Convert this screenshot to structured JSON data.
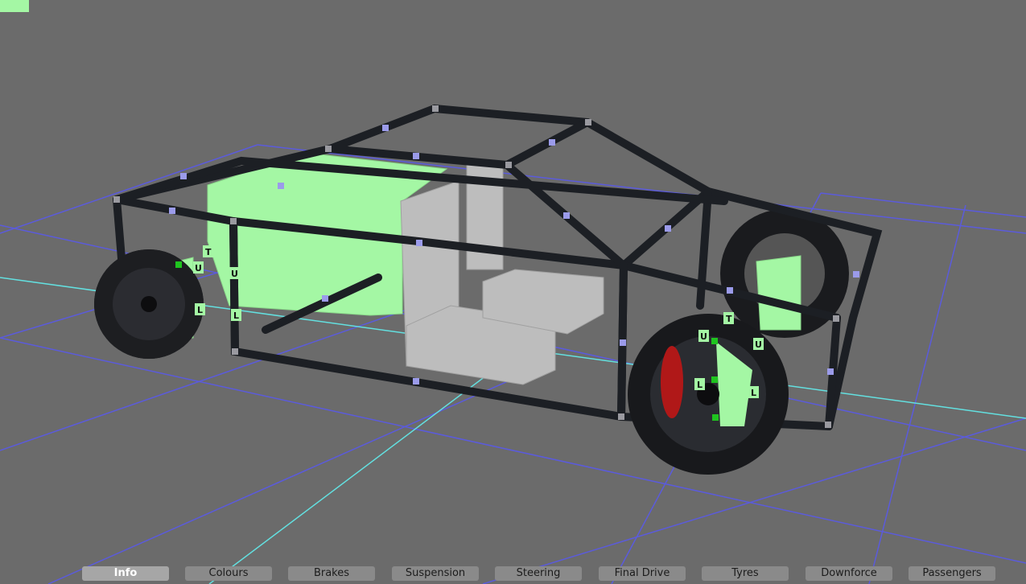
{
  "scene": {
    "title": "Chassis editor viewport",
    "colors": {
      "background": "#6b6b6b",
      "grid": "#5b5bdc",
      "axis": "#63e0e0",
      "body_block": "#a4f7a4",
      "tube": "#1c1f24",
      "seat": "#bdbdbd",
      "caliper": "#b01818",
      "node": "#9a9aa0",
      "handle": "#9b9bea",
      "active_handle": "#1fc41f"
    },
    "markers": {
      "top": "T",
      "upper": "U",
      "lower": "L"
    }
  },
  "tabs": [
    {
      "label": "Info",
      "active": true
    },
    {
      "label": "Colours",
      "active": false
    },
    {
      "label": "Brakes",
      "active": false
    },
    {
      "label": "Suspension",
      "active": false
    },
    {
      "label": "Steering",
      "active": false
    },
    {
      "label": "Final Drive",
      "active": false
    },
    {
      "label": "Tyres",
      "active": false
    },
    {
      "label": "Downforce",
      "active": false
    },
    {
      "label": "Passengers",
      "active": false
    }
  ]
}
